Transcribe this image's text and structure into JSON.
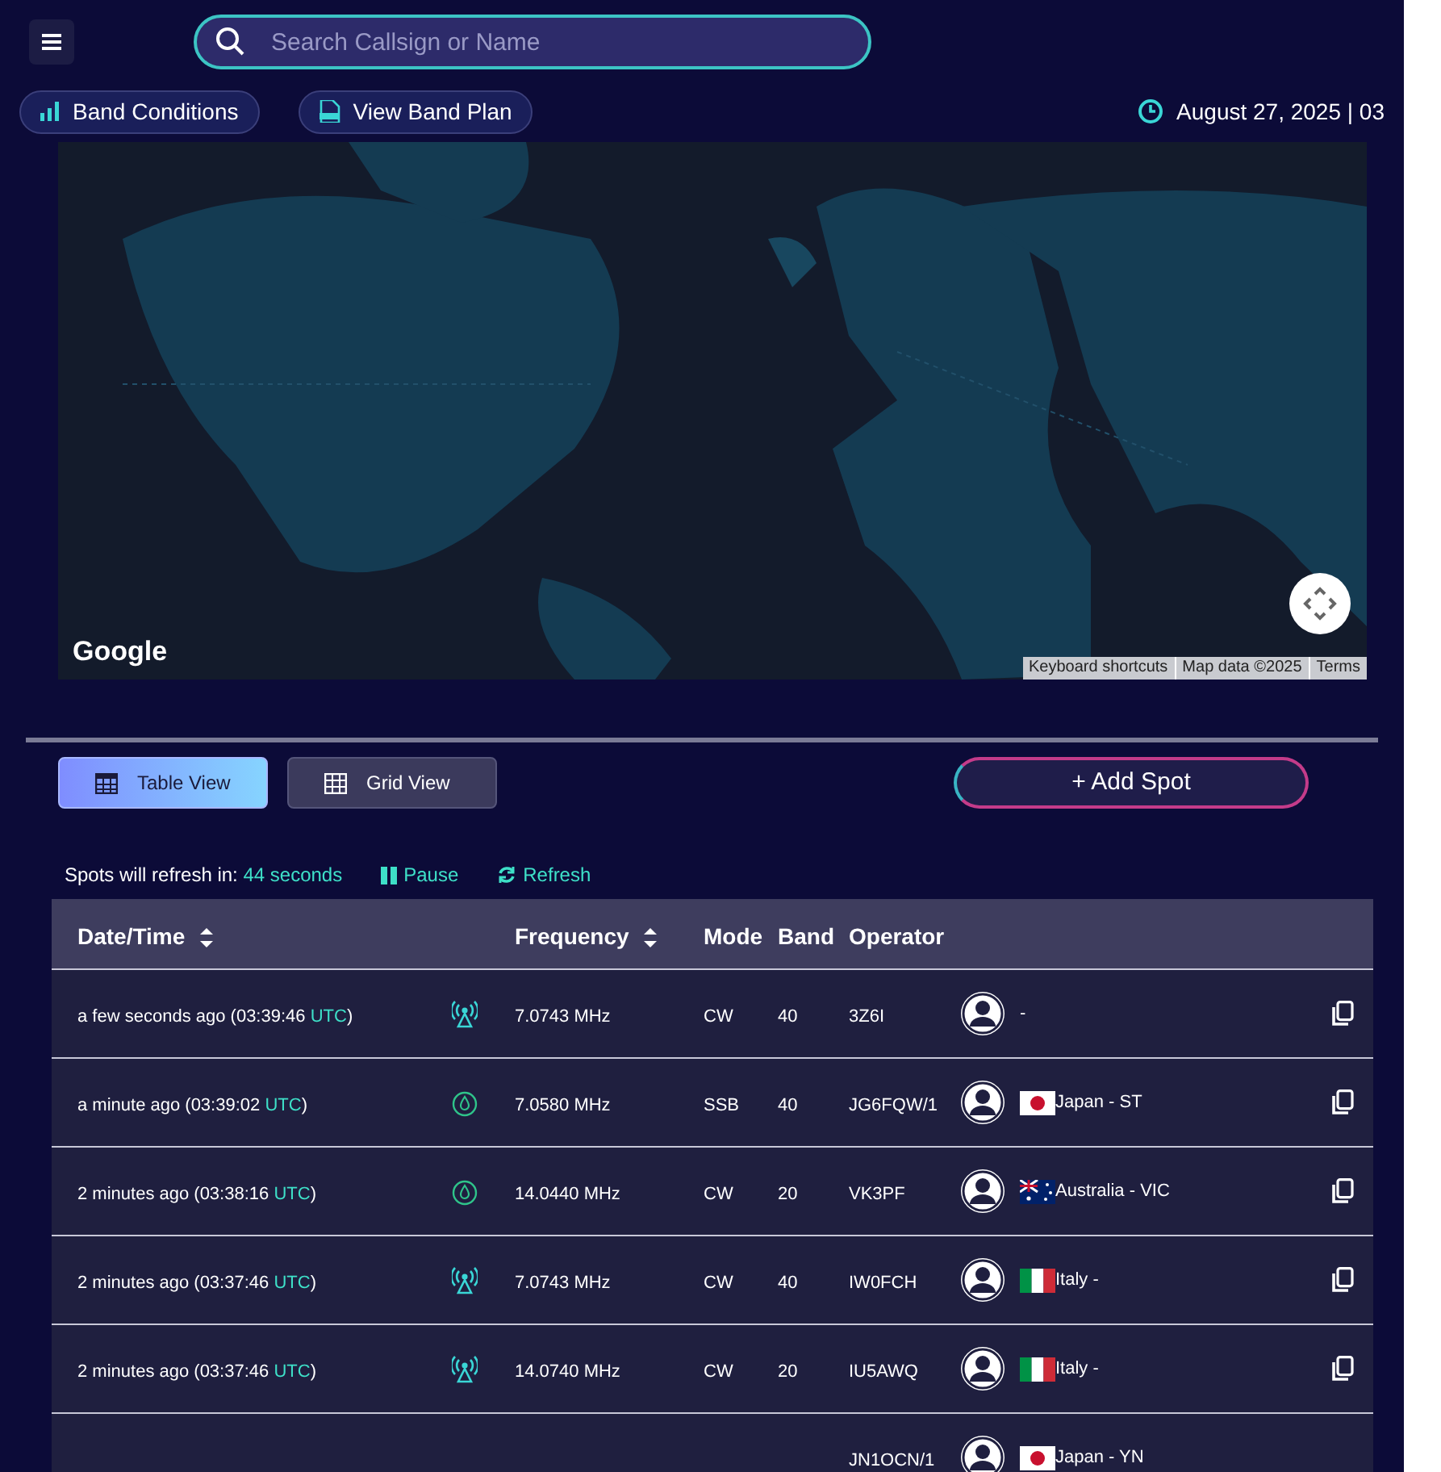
{
  "header": {
    "search": {
      "placeholder": "Search Callsign or Name"
    },
    "buttons": [
      {
        "label": "Band Conditions",
        "kind": "bars"
      },
      {
        "label": "View Band Plan",
        "kind": "pdf"
      }
    ],
    "datetime": "August 27, 2025 | 03"
  },
  "map": {
    "attribution": [
      "Keyboard shortcuts",
      "Map data ©2025",
      "Terms"
    ],
    "brand": "Google"
  },
  "views": [
    {
      "label": "Table View",
      "kind": "table",
      "selected": true
    },
    {
      "label": "Grid View",
      "kind": "grid",
      "selected": false
    }
  ],
  "add_button": "+ Add Spot",
  "refresh": {
    "label": "Spots will refresh in:",
    "countdown": "44 seconds",
    "pause": "Pause",
    "refresh": "Refresh"
  },
  "table": {
    "columns": [
      {
        "label": "Date/Time",
        "sortable": true
      },
      {
        "label": "Frequency",
        "sortable": true
      },
      {
        "label": "Mode",
        "sortable": false
      },
      {
        "label": "Band",
        "sortable": false
      },
      {
        "label": "Operator",
        "sortable": false
      }
    ],
    "rows": [
      {
        "time": {
          "text": "a few seconds ago (03:39:46 ",
          "zone": "UTC",
          "end": ")"
        },
        "source": {
          "kind": "antenna"
        },
        "frequency": "7.0743 MHz",
        "mode": "CW",
        "band": "40",
        "callsign": "3Z6I",
        "location": "-"
      },
      {
        "time": {
          "text": "a minute ago (03:39:02 ",
          "zone": "UTC",
          "end": ")"
        },
        "source": {
          "kind": "drop"
        },
        "frequency": "7.0580 MHz",
        "mode": "SSB",
        "band": "40",
        "callsign": "JG6FQW/1",
        "flag": {
          "kind": "jp"
        },
        "location": "Japan - ST"
      },
      {
        "time": {
          "text": "2 minutes ago (03:38:16 ",
          "zone": "UTC",
          "end": ")"
        },
        "source": {
          "kind": "drop"
        },
        "frequency": "14.0440 MHz",
        "mode": "CW",
        "band": "20",
        "callsign": "VK3PF",
        "flag": {
          "kind": "au"
        },
        "location": "Australia - VIC"
      },
      {
        "time": {
          "text": "2 minutes ago (03:37:46 ",
          "zone": "UTC",
          "end": ")"
        },
        "source": {
          "kind": "antenna"
        },
        "frequency": "7.0743 MHz",
        "mode": "CW",
        "band": "40",
        "callsign": "IW0FCH",
        "flag": {
          "kind": "it"
        },
        "location": "Italy -"
      },
      {
        "time": {
          "text": "2 minutes ago (03:37:46 ",
          "zone": "UTC",
          "end": ")"
        },
        "source": {
          "kind": "antenna"
        },
        "frequency": "14.0740 MHz",
        "mode": "CW",
        "band": "20",
        "callsign": "IU5AWQ",
        "flag": {
          "kind": "it"
        },
        "location": "Italy -"
      },
      {
        "callsign": "JN1OCN/1",
        "flag": {
          "kind": "jp"
        },
        "location": "Japan - YN"
      }
    ]
  }
}
